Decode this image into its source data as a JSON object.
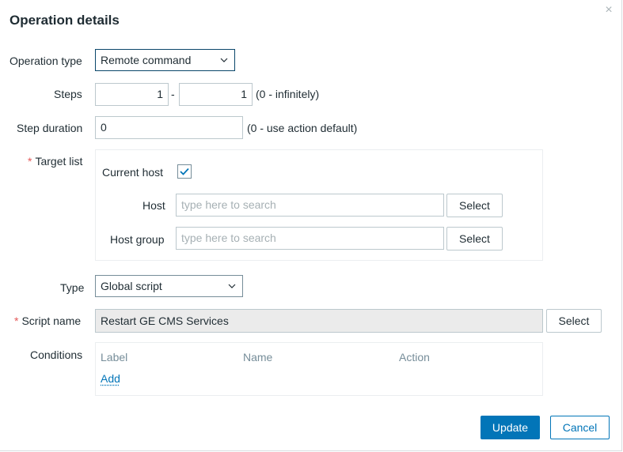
{
  "dialog": {
    "title": "Operation details",
    "close_symbol": "×"
  },
  "form": {
    "operation_type": {
      "label": "Operation type",
      "value": "Remote command"
    },
    "steps": {
      "label": "Steps",
      "from": "1",
      "separator": "-",
      "to": "1",
      "hint": "(0 - infinitely)"
    },
    "step_duration": {
      "label": "Step duration",
      "value": "0",
      "hint": "(0 - use action default)"
    },
    "target_list": {
      "required_mark": "*",
      "label": "Target list",
      "current_host_label": "Current host",
      "current_host_checked": true,
      "host_label": "Host",
      "host_placeholder": "type here to search",
      "host_group_label": "Host group",
      "host_group_placeholder": "type here to search",
      "select_label": "Select"
    },
    "type": {
      "label": "Type",
      "value": "Global script"
    },
    "script_name": {
      "required_mark": "*",
      "label": "Script name",
      "value": "Restart GE CMS Services",
      "select_label": "Select"
    },
    "conditions": {
      "label": "Conditions",
      "columns": [
        "Label",
        "Name",
        "Action"
      ],
      "add_label": "Add"
    }
  },
  "footer": {
    "update_label": "Update",
    "cancel_label": "Cancel"
  },
  "colors": {
    "primary": "#0275b8",
    "required": "#e45959",
    "border": "#bcc8cd",
    "readonly_bg": "#ebebeb"
  }
}
